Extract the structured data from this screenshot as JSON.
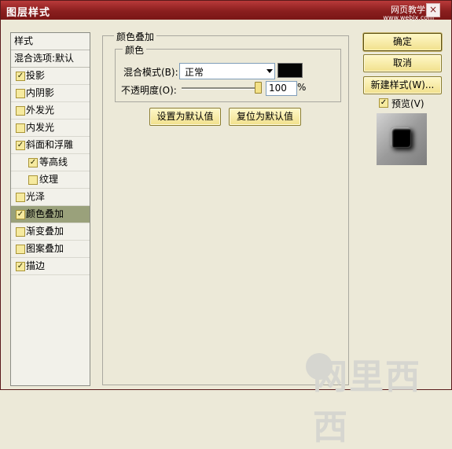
{
  "window": {
    "title": "图层样式",
    "close_label": "×",
    "watermark_line1": "网页教学网",
    "watermark_line2": "www.webjx.com"
  },
  "styles_list": {
    "header": "样式",
    "blend_options": "混合选项:默认",
    "items": [
      {
        "label": "投影",
        "checked": true
      },
      {
        "label": "内阴影",
        "checked": false
      },
      {
        "label": "外发光",
        "checked": false
      },
      {
        "label": "内发光",
        "checked": false
      },
      {
        "label": "斜面和浮雕",
        "checked": true
      },
      {
        "label": "等高线",
        "checked": true
      },
      {
        "label": "纹理",
        "checked": false
      },
      {
        "label": "光泽",
        "checked": false
      },
      {
        "label": "颜色叠加",
        "checked": true,
        "selected": true
      },
      {
        "label": "渐变叠加",
        "checked": false
      },
      {
        "label": "图案叠加",
        "checked": false
      },
      {
        "label": "描边",
        "checked": true
      }
    ]
  },
  "overlay": {
    "group_title": "颜色叠加",
    "subgroup_title": "颜色",
    "blend_mode_label": "混合模式(B):",
    "blend_mode_value": "正常",
    "color": "#050505",
    "opacity_label": "不透明度(O):",
    "opacity_value": "100",
    "opacity_fraction": 1.0,
    "opacity_unit": "%",
    "set_default_label": "设置为默认值",
    "reset_default_label": "复位为默认值"
  },
  "actions": {
    "ok_label": "确定",
    "cancel_label": "取消",
    "new_style_label": "新建样式(W)...",
    "preview_label": "预览(V)",
    "preview_checked": true
  },
  "bottom_watermark": "网里西西"
}
